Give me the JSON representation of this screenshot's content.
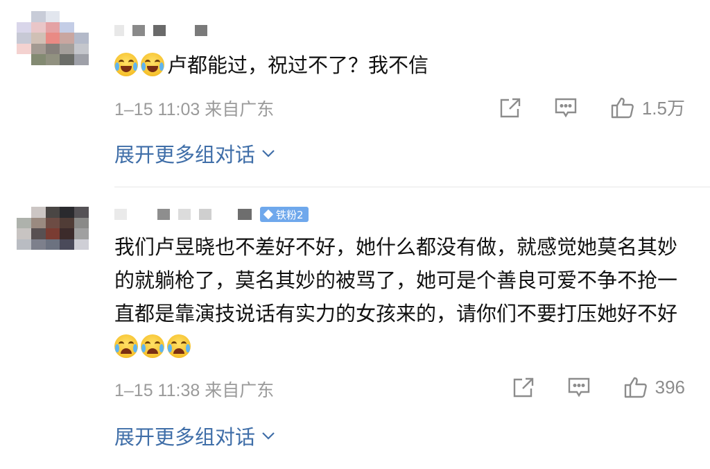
{
  "comments": [
    {
      "text": "卢都能过，祝过不了？我不信",
      "time": "1–15 11:03",
      "source": "来自广东",
      "likes": "1.5万",
      "expand_label": "展开更多组对话",
      "leading_emoji": [
        "laugh-cry",
        "laugh-cry"
      ]
    },
    {
      "badge": "铁粉2",
      "text": "我们卢昱晓也不差好不好，她什么都没有做，就感觉她莫名其妙的就躺枪了，莫名其妙的被骂了，她可是个善良可爱不争不抢一直都是靠演技说话有实力的女孩来的，请你们不要打压她好不好",
      "time": "1–15 11:38",
      "source": "来自广东",
      "likes": "396",
      "expand_label": "展开更多组对话",
      "trailing_emoji": [
        "crying",
        "crying",
        "crying"
      ]
    }
  ],
  "colors": {
    "link": "#3f6ea8",
    "meta": "#9a9a9a",
    "badge": "#6fa8ec",
    "avatar1": [
      "#ffffff",
      "#c8ccd8",
      "#e2e6ee",
      "#ffffff",
      "#ffffff",
      "#d9d6ea",
      "#e9c6c8",
      "#e4a2a4",
      "#c4cde6",
      "#ffffff",
      "#c7c9d5",
      "#d0c0b5",
      "#e98a84",
      "#c9a6a0",
      "#b3b9c9",
      "#f4d2d0",
      "#a39a92",
      "#86807b",
      "#a49f9b",
      "#c4c6cc",
      "#ffffff",
      "#838a72",
      "#919180",
      "#6b6d68",
      "#9ea0a8"
    ],
    "avatar2": [
      "#ffffff",
      "#ccc6c4",
      "#4a4644",
      "#2a2a2e",
      "#555256",
      "#aeb2ac",
      "#9a8a80",
      "#6d4c44",
      "#503c36",
      "#8a8a88",
      "#c8c4c2",
      "#585052",
      "#7a3c32",
      "#3c2b2b",
      "#a0a0a0",
      "#b9bcc2",
      "#7d808c",
      "#6c7280",
      "#4a4a5a",
      "#cfcfd6",
      "#ffffff",
      "#ffffff",
      "#ffffff",
      "#ffffff",
      "#ffffff"
    ]
  }
}
